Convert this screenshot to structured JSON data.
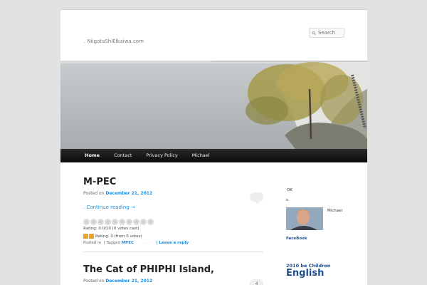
{
  "site": {
    "description": ". NiigataShiEikaiwa.com",
    "search_placeholder": "Search"
  },
  "nav": {
    "items": [
      {
        "label": "Home",
        "current": true
      },
      {
        "label": "Contact"
      },
      {
        "label": "Privacy Policy"
      },
      {
        "label": "Michael"
      }
    ]
  },
  "posts": [
    {
      "title": "M-PEC",
      "posted_on_label": "Posted on",
      "date": "December 21, 2012",
      "comments": "",
      "continue": ". Continue reading →",
      "rating_text": "Rating: 0.0/10 (0 votes cast)",
      "thumbs_text": "Rating: 0 (from 0 votes)",
      "posted_in": "Posted in",
      "tagged": "| Tagged",
      "tag": "MPEC",
      "dot": ".",
      "leave_reply": "| Leave a reply"
    },
    {
      "title": "The Cat of PHIPHI Island,",
      "posted_on_label": "Posted on",
      "date": "December 21, 2012",
      "comments": "4"
    }
  ],
  "sidebar": {
    "ok": "OK",
    "s": "s.",
    "author": "Michael",
    "facebook": "FaceBook",
    "section_title": "2010 be Children",
    "big_text": "English"
  },
  "colors": {
    "link": "#1b8be0",
    "nav_bg": "#111111",
    "accent_blue": "#1b4f8f"
  }
}
